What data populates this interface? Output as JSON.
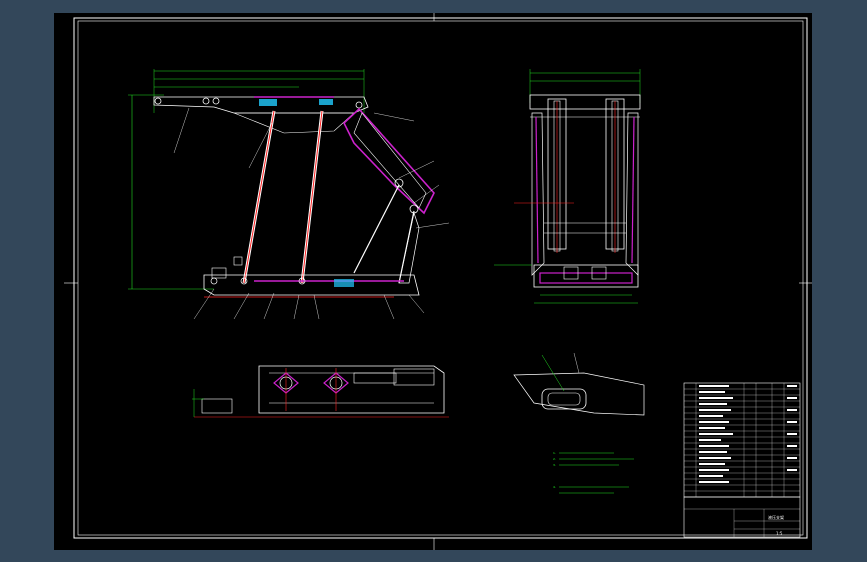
{
  "view": {
    "background": "#33475a",
    "sheet_color": "#000000",
    "colors": {
      "outline": "#ffffff",
      "dimension": "#22dd22",
      "cylinder": "#ff2a2a",
      "highlight": "#cc22cc",
      "accent": "#22ccff",
      "text": "#ffffff"
    }
  },
  "titleblock": {
    "scale": "1:5",
    "name": "液压支架"
  },
  "notes": [
    "1.",
    "2.",
    "3.",
    "4."
  ]
}
